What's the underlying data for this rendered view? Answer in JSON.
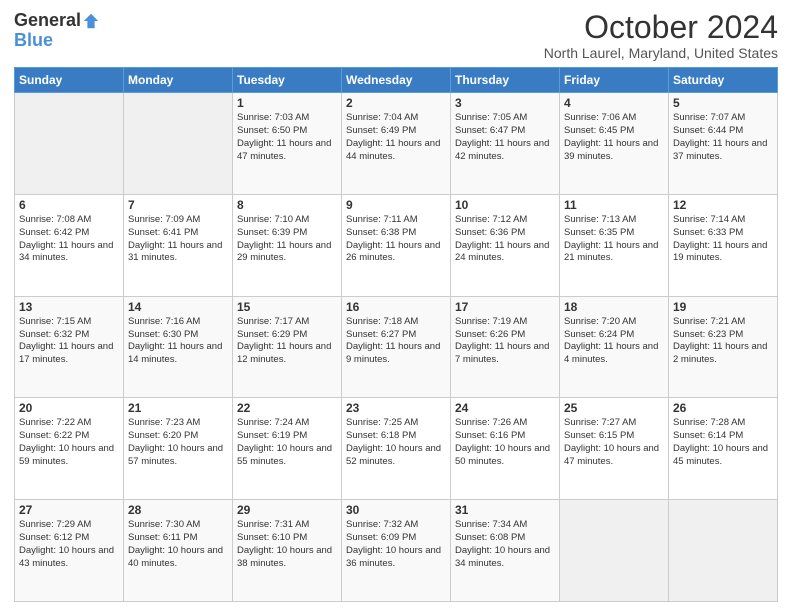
{
  "header": {
    "logo": {
      "general": "General",
      "blue": "Blue",
      "tagline": ""
    },
    "title": "October 2024",
    "location": "North Laurel, Maryland, United States"
  },
  "calendar": {
    "days_of_week": [
      "Sunday",
      "Monday",
      "Tuesday",
      "Wednesday",
      "Thursday",
      "Friday",
      "Saturday"
    ],
    "weeks": [
      [
        {
          "day": "",
          "content": ""
        },
        {
          "day": "",
          "content": ""
        },
        {
          "day": "1",
          "content": "Sunrise: 7:03 AM\nSunset: 6:50 PM\nDaylight: 11 hours and 47 minutes."
        },
        {
          "day": "2",
          "content": "Sunrise: 7:04 AM\nSunset: 6:49 PM\nDaylight: 11 hours and 44 minutes."
        },
        {
          "day": "3",
          "content": "Sunrise: 7:05 AM\nSunset: 6:47 PM\nDaylight: 11 hours and 42 minutes."
        },
        {
          "day": "4",
          "content": "Sunrise: 7:06 AM\nSunset: 6:45 PM\nDaylight: 11 hours and 39 minutes."
        },
        {
          "day": "5",
          "content": "Sunrise: 7:07 AM\nSunset: 6:44 PM\nDaylight: 11 hours and 37 minutes."
        }
      ],
      [
        {
          "day": "6",
          "content": "Sunrise: 7:08 AM\nSunset: 6:42 PM\nDaylight: 11 hours and 34 minutes."
        },
        {
          "day": "7",
          "content": "Sunrise: 7:09 AM\nSunset: 6:41 PM\nDaylight: 11 hours and 31 minutes."
        },
        {
          "day": "8",
          "content": "Sunrise: 7:10 AM\nSunset: 6:39 PM\nDaylight: 11 hours and 29 minutes."
        },
        {
          "day": "9",
          "content": "Sunrise: 7:11 AM\nSunset: 6:38 PM\nDaylight: 11 hours and 26 minutes."
        },
        {
          "day": "10",
          "content": "Sunrise: 7:12 AM\nSunset: 6:36 PM\nDaylight: 11 hours and 24 minutes."
        },
        {
          "day": "11",
          "content": "Sunrise: 7:13 AM\nSunset: 6:35 PM\nDaylight: 11 hours and 21 minutes."
        },
        {
          "day": "12",
          "content": "Sunrise: 7:14 AM\nSunset: 6:33 PM\nDaylight: 11 hours and 19 minutes."
        }
      ],
      [
        {
          "day": "13",
          "content": "Sunrise: 7:15 AM\nSunset: 6:32 PM\nDaylight: 11 hours and 17 minutes."
        },
        {
          "day": "14",
          "content": "Sunrise: 7:16 AM\nSunset: 6:30 PM\nDaylight: 11 hours and 14 minutes."
        },
        {
          "day": "15",
          "content": "Sunrise: 7:17 AM\nSunset: 6:29 PM\nDaylight: 11 hours and 12 minutes."
        },
        {
          "day": "16",
          "content": "Sunrise: 7:18 AM\nSunset: 6:27 PM\nDaylight: 11 hours and 9 minutes."
        },
        {
          "day": "17",
          "content": "Sunrise: 7:19 AM\nSunset: 6:26 PM\nDaylight: 11 hours and 7 minutes."
        },
        {
          "day": "18",
          "content": "Sunrise: 7:20 AM\nSunset: 6:24 PM\nDaylight: 11 hours and 4 minutes."
        },
        {
          "day": "19",
          "content": "Sunrise: 7:21 AM\nSunset: 6:23 PM\nDaylight: 11 hours and 2 minutes."
        }
      ],
      [
        {
          "day": "20",
          "content": "Sunrise: 7:22 AM\nSunset: 6:22 PM\nDaylight: 10 hours and 59 minutes."
        },
        {
          "day": "21",
          "content": "Sunrise: 7:23 AM\nSunset: 6:20 PM\nDaylight: 10 hours and 57 minutes."
        },
        {
          "day": "22",
          "content": "Sunrise: 7:24 AM\nSunset: 6:19 PM\nDaylight: 10 hours and 55 minutes."
        },
        {
          "day": "23",
          "content": "Sunrise: 7:25 AM\nSunset: 6:18 PM\nDaylight: 10 hours and 52 minutes."
        },
        {
          "day": "24",
          "content": "Sunrise: 7:26 AM\nSunset: 6:16 PM\nDaylight: 10 hours and 50 minutes."
        },
        {
          "day": "25",
          "content": "Sunrise: 7:27 AM\nSunset: 6:15 PM\nDaylight: 10 hours and 47 minutes."
        },
        {
          "day": "26",
          "content": "Sunrise: 7:28 AM\nSunset: 6:14 PM\nDaylight: 10 hours and 45 minutes."
        }
      ],
      [
        {
          "day": "27",
          "content": "Sunrise: 7:29 AM\nSunset: 6:12 PM\nDaylight: 10 hours and 43 minutes."
        },
        {
          "day": "28",
          "content": "Sunrise: 7:30 AM\nSunset: 6:11 PM\nDaylight: 10 hours and 40 minutes."
        },
        {
          "day": "29",
          "content": "Sunrise: 7:31 AM\nSunset: 6:10 PM\nDaylight: 10 hours and 38 minutes."
        },
        {
          "day": "30",
          "content": "Sunrise: 7:32 AM\nSunset: 6:09 PM\nDaylight: 10 hours and 36 minutes."
        },
        {
          "day": "31",
          "content": "Sunrise: 7:34 AM\nSunset: 6:08 PM\nDaylight: 10 hours and 34 minutes."
        },
        {
          "day": "",
          "content": ""
        },
        {
          "day": "",
          "content": ""
        }
      ]
    ]
  }
}
